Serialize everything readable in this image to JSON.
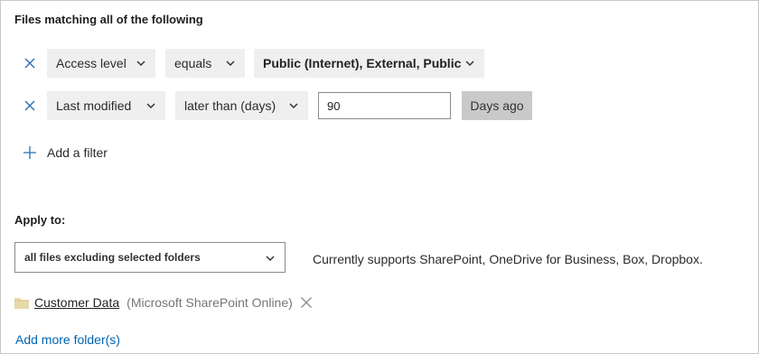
{
  "heading": "Files matching all of the following",
  "filters": [
    {
      "field": "Access level",
      "operator": "equals",
      "value": "Public (Internet), External, Public"
    },
    {
      "field": "Last modified",
      "operator": "later than (days)",
      "value": "90",
      "suffix": "Days ago"
    }
  ],
  "add_filter_label": "Add a filter",
  "apply_to": {
    "label": "Apply to:",
    "selected": "all files excluding selected folders",
    "note": "Currently supports SharePoint, OneDrive for Business, Box, Dropbox."
  },
  "folders": [
    {
      "name": "Customer Data",
      "source": "(Microsoft SharePoint Online)"
    }
  ],
  "add_more_label": "Add more folder(s)",
  "colors": {
    "accent": "#0063b1",
    "dropdown_bg": "#efefef",
    "suffix_bg": "#c9c9c9",
    "folder": "#e8d9a8"
  },
  "icons": {
    "remove": "close-icon",
    "chevron": "chevron-down-icon",
    "add": "plus-icon",
    "folder": "folder-icon"
  }
}
